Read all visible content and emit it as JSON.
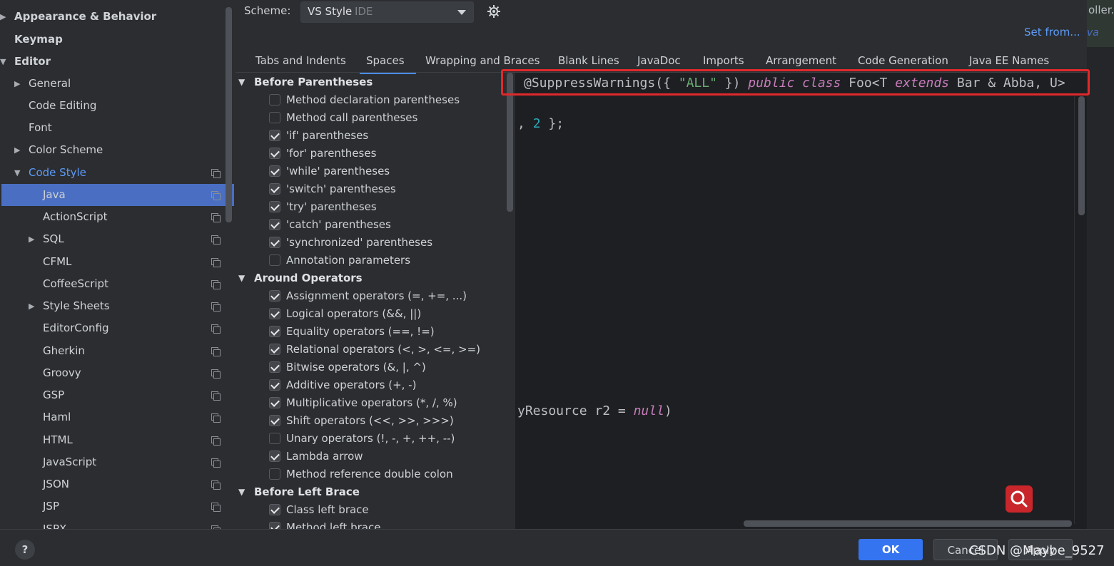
{
  "sidebar": {
    "items": [
      {
        "label": "Appearance & Behavior",
        "arrow": "▶"
      },
      {
        "label": "Keymap",
        "arrow": ""
      },
      {
        "label": "Editor",
        "arrow": "▼"
      },
      {
        "label": "General",
        "arrow": "▶"
      },
      {
        "label": "Code Editing",
        "arrow": ""
      },
      {
        "label": "Font",
        "arrow": ""
      },
      {
        "label": "Color Scheme",
        "arrow": "▶"
      },
      {
        "label": "Code Style",
        "arrow": "▼"
      },
      {
        "label": "Java",
        "arrow": ""
      },
      {
        "label": "ActionScript",
        "arrow": ""
      },
      {
        "label": "SQL",
        "arrow": "▶"
      },
      {
        "label": "CFML",
        "arrow": ""
      },
      {
        "label": "CoffeeScript",
        "arrow": ""
      },
      {
        "label": "Style Sheets",
        "arrow": "▶"
      },
      {
        "label": "EditorConfig",
        "arrow": ""
      },
      {
        "label": "Gherkin",
        "arrow": ""
      },
      {
        "label": "Groovy",
        "arrow": ""
      },
      {
        "label": "GSP",
        "arrow": ""
      },
      {
        "label": "Haml",
        "arrow": ""
      },
      {
        "label": "HTML",
        "arrow": ""
      },
      {
        "label": "JavaScript",
        "arrow": ""
      },
      {
        "label": "JSON",
        "arrow": ""
      },
      {
        "label": "JSP",
        "arrow": ""
      },
      {
        "label": "JSPX",
        "arrow": ""
      }
    ]
  },
  "scheme": {
    "label": "Scheme:",
    "value": "VS Style",
    "suffix": "IDE"
  },
  "set_from": "Set from...",
  "right_strip": {
    "text1": "oller.",
    "text2": "va"
  },
  "tabs": [
    "Tabs and Indents",
    "Spaces",
    "Wrapping and Braces",
    "Blank Lines",
    "JavaDoc",
    "Imports",
    "Arrangement",
    "Code Generation",
    "Java EE Names"
  ],
  "active_tab": "Spaces",
  "sections": [
    {
      "title": "Before Parentheses",
      "options": [
        {
          "label": "Method declaration parentheses",
          "checked": false
        },
        {
          "label": "Method call parentheses",
          "checked": false
        },
        {
          "label": "'if' parentheses",
          "checked": true
        },
        {
          "label": "'for' parentheses",
          "checked": true
        },
        {
          "label": "'while' parentheses",
          "checked": true
        },
        {
          "label": "'switch' parentheses",
          "checked": true
        },
        {
          "label": "'try' parentheses",
          "checked": true
        },
        {
          "label": "'catch' parentheses",
          "checked": true
        },
        {
          "label": "'synchronized' parentheses",
          "checked": true
        },
        {
          "label": "Annotation parameters",
          "checked": false
        }
      ]
    },
    {
      "title": "Around Operators",
      "options": [
        {
          "label": "Assignment operators (=, +=, ...)",
          "checked": true
        },
        {
          "label": "Logical operators (&&, ||)",
          "checked": true
        },
        {
          "label": "Equality operators (==, !=)",
          "checked": true
        },
        {
          "label": "Relational operators (<, >, <=, >=)",
          "checked": true
        },
        {
          "label": "Bitwise operators (&, |, ^)",
          "checked": true
        },
        {
          "label": "Additive operators (+, -)",
          "checked": true
        },
        {
          "label": "Multiplicative operators (*, /, %)",
          "checked": true
        },
        {
          "label": "Shift operators (<<, >>, >>>)",
          "checked": true
        },
        {
          "label": "Unary operators (!, -, +, ++, --)",
          "checked": false
        },
        {
          "label": "Lambda arrow",
          "checked": true
        },
        {
          "label": "Method reference double colon",
          "checked": false
        }
      ]
    },
    {
      "title": "Before Left Brace",
      "options": [
        {
          "label": "Class left brace",
          "checked": true
        },
        {
          "label": "Method left brace",
          "checked": true
        }
      ]
    }
  ],
  "preview": {
    "line1": [
      {
        "t": "@SuppressWarnings({ ",
        "c": ""
      },
      {
        "t": "\"ALL\"",
        "c": "c-str"
      },
      {
        "t": " }) ",
        "c": ""
      },
      {
        "t": "public class",
        "c": "c-kw"
      },
      {
        "t": " Foo<T ",
        "c": ""
      },
      {
        "t": "extends",
        "c": "c-kw"
      },
      {
        "t": " Bar & Abba, U>",
        "c": ""
      }
    ],
    "line2": [
      {
        "t": ", ",
        "c": ""
      },
      {
        "t": "2",
        "c": "c-num"
      },
      {
        "t": " };",
        "c": ""
      }
    ],
    "line3": [
      {
        "t": "yResource r2 = ",
        "c": ""
      },
      {
        "t": "null",
        "c": "c-kw"
      },
      {
        "t": ")",
        "c": ""
      }
    ]
  },
  "buttons": {
    "help": "?",
    "ok": "OK",
    "cancel": "Cancel",
    "apply": "Apply"
  },
  "watermark": "CSDN @Maybe_9527",
  "colors": {
    "accent": "#3574f0",
    "selection": "#4a6fc2",
    "highlight_box": "#e0292b",
    "fab": "#c8262b"
  }
}
